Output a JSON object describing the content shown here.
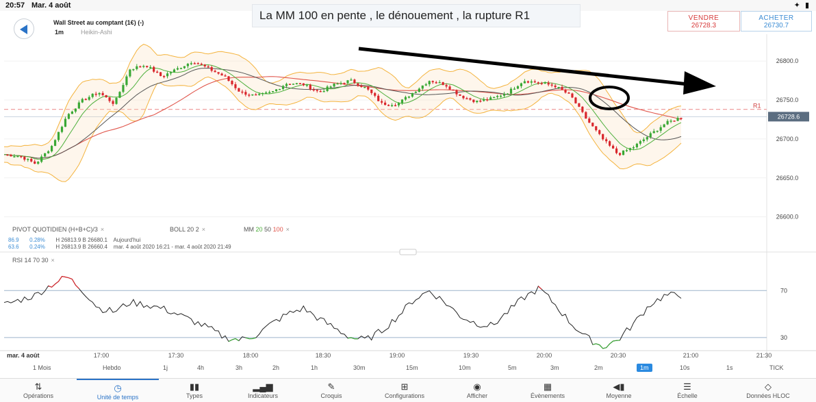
{
  "status_bar": {
    "time": "20:57",
    "date": "Mar. 4 août",
    "icons": "✦ ▮"
  },
  "header": {
    "instrument": "Wall Street au comptant (1€) (-)",
    "interval": "1m",
    "chart_type": "Heikin-Ashi"
  },
  "annotation": "La MM 100 en pente , le dénouement , la rupture R1",
  "trade": {
    "sell_label": "VENDRE",
    "sell_price": "26728.3",
    "buy_label": "ACHETER",
    "buy_price": "26730.7"
  },
  "price_axis": {
    "labels": [
      "26800.0",
      "26750.0",
      "26700.0",
      "26650.0",
      "26600.0"
    ],
    "current_price": "26728.6",
    "r1_label": "R1"
  },
  "legend": {
    "pivot": "PIVOT QUOTIDIEN (H+B+C)/3",
    "boll": "BOLL 20 2",
    "mm_label": "MM",
    "mm_20": "20",
    "mm_50": "50",
    "mm_100": "100",
    "close": "×"
  },
  "info": {
    "row1_a": "86.9",
    "row1_b": "0.28%",
    "row1_c": "H 26813.9  B 26680.1",
    "row1_d": "Aujourd'hui",
    "row2_a": "63.6",
    "row2_b": "0.24%",
    "row2_c": "H 26813.9  B 26660.4",
    "row2_d": "mar. 4 août 2020 16:21 - mar. 4 août 2020 21:49"
  },
  "rsi": {
    "label": "RSI 14 70 30",
    "level_high": "70",
    "level_low": "30"
  },
  "time_axis": {
    "first_label": "mar. 4 août",
    "labels": [
      "17:00",
      "17:30",
      "18:00",
      "18:30",
      "19:00",
      "19:30",
      "20:00",
      "20:30",
      "21:00",
      "21:30"
    ]
  },
  "timeframes": [
    "1 Mois",
    "Hebdo",
    "1j",
    "4h",
    "3h",
    "2h",
    "1h",
    "30m",
    "15m",
    "10m",
    "5m",
    "3m",
    "2m",
    "1m",
    "10s",
    "1s",
    "TICK"
  ],
  "active_timeframe": "1m",
  "bottom_nav": [
    {
      "label": "Opérations",
      "icon": "⇅"
    },
    {
      "label": "Unité de temps",
      "icon": "◷"
    },
    {
      "label": "Types",
      "icon": "▮▮"
    },
    {
      "label": "Indicateurs",
      "icon": "▂▄▆"
    },
    {
      "label": "Croquis",
      "icon": "✎"
    },
    {
      "label": "Configurations",
      "icon": "⊞"
    },
    {
      "label": "Afficher",
      "icon": "◉"
    },
    {
      "label": "Évènements",
      "icon": "▦"
    },
    {
      "label": "Moyenne",
      "icon": "◀▮"
    },
    {
      "label": "Échelle",
      "icon": "☰"
    },
    {
      "label": "Données HLOC",
      "icon": "◇"
    }
  ],
  "colors": {
    "bull": "#3aa835",
    "bear": "#d9262c",
    "boll": "#f4b33d",
    "mm20": "#4caf3a",
    "mm50": "#555555",
    "mm100": "#e0554b",
    "rsi": "#222222",
    "accent": "#2a73c7"
  },
  "chart_data": {
    "type": "candlestick",
    "y_range": [
      26590,
      26830
    ],
    "price_series_approx": [
      26680,
      26678,
      26668,
      26690,
      26730,
      26750,
      26760,
      26745,
      26790,
      26795,
      26780,
      26790,
      26800,
      26790,
      26780,
      26760,
      26755,
      26760,
      26772,
      26770,
      26760,
      26770,
      26775,
      26765,
      26745,
      26745,
      26760,
      26775,
      26770,
      26755,
      26748,
      26752,
      26760,
      26775,
      26772,
      26768,
      26755,
      26725,
      26700,
      26680,
      26690,
      26705,
      26720,
      26728
    ],
    "rsi_range": [
      0,
      100
    ],
    "rsi_approx": [
      58,
      62,
      66,
      75,
      82,
      70,
      55,
      52,
      60,
      58,
      55,
      50,
      44,
      38,
      30,
      28,
      32,
      42,
      50,
      55,
      46,
      38,
      30,
      28,
      36,
      48,
      62,
      70,
      60,
      48,
      42,
      40,
      52,
      64,
      72,
      58,
      42,
      30,
      22,
      28,
      42,
      58,
      66,
      66
    ]
  }
}
